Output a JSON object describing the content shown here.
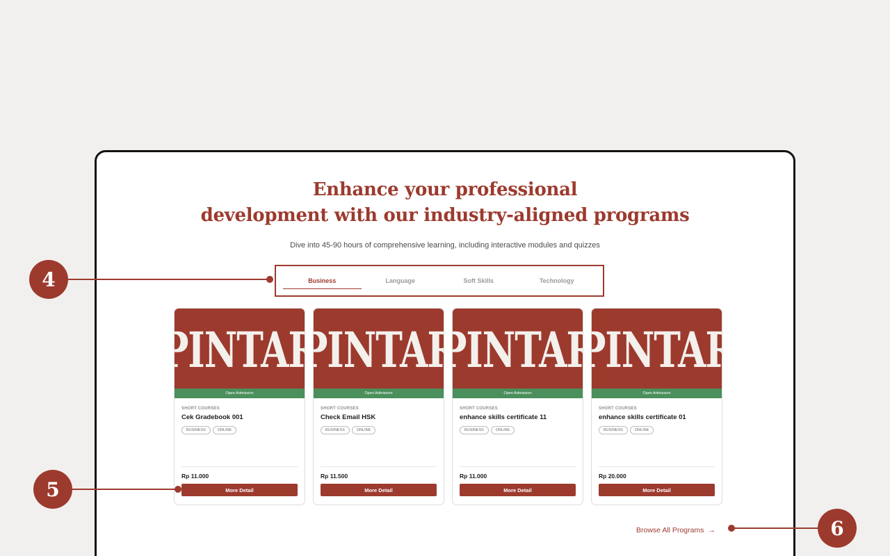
{
  "section": {
    "headline_line1": "Enhance your professional",
    "headline_line2": "development with our industry-aligned programs",
    "subtitle": "Dive into 45-90 hours of comprehensive learning, including interactive modules and quizzes"
  },
  "tabs": [
    {
      "label": "Business",
      "active": true
    },
    {
      "label": "Language",
      "active": false
    },
    {
      "label": "Soft Skills",
      "active": false
    },
    {
      "label": "Technology",
      "active": false
    }
  ],
  "cards": [
    {
      "logo_text": "PINTAR",
      "admission": "Open Admission",
      "category": "SHORT COURSES",
      "title": "Cek Gradebook 001",
      "tags": [
        "BUSINESS",
        "ONLINE"
      ],
      "price": "Rp 11.000",
      "button": "More Detail"
    },
    {
      "logo_text": "PINTAR",
      "admission": "Open Admission",
      "category": "SHORT COURSES",
      "title": "Check Email HSK",
      "tags": [
        "BUSINESS",
        "ONLINE"
      ],
      "price": "Rp 11.500",
      "button": "More Detail"
    },
    {
      "logo_text": "PINTAR",
      "admission": "Open Admission",
      "category": "SHORT COURSES",
      "title": "enhance skills certificate 11",
      "tags": [
        "BUSINESS",
        "ONLINE"
      ],
      "price": "Rp 11.000",
      "button": "More Detail"
    },
    {
      "logo_text": "PINTAR",
      "admission": "Open Admission",
      "category": "SHORT COURSES",
      "title": "enhance skills certificate 01",
      "tags": [
        "BUSINESS",
        "ONLINE"
      ],
      "price": "Rp 20.000",
      "button": "More Detail"
    }
  ],
  "browse": {
    "label": "Browse All Programs",
    "arrow": "→",
    "icon": "arrow-right-icon"
  },
  "callouts": [
    "4",
    "5",
    "6"
  ],
  "colors": {
    "accent": "#9c3a2e",
    "admission_green": "#4a8f5c",
    "page_bg": "#f2f0ee",
    "frame_border": "#121212"
  }
}
